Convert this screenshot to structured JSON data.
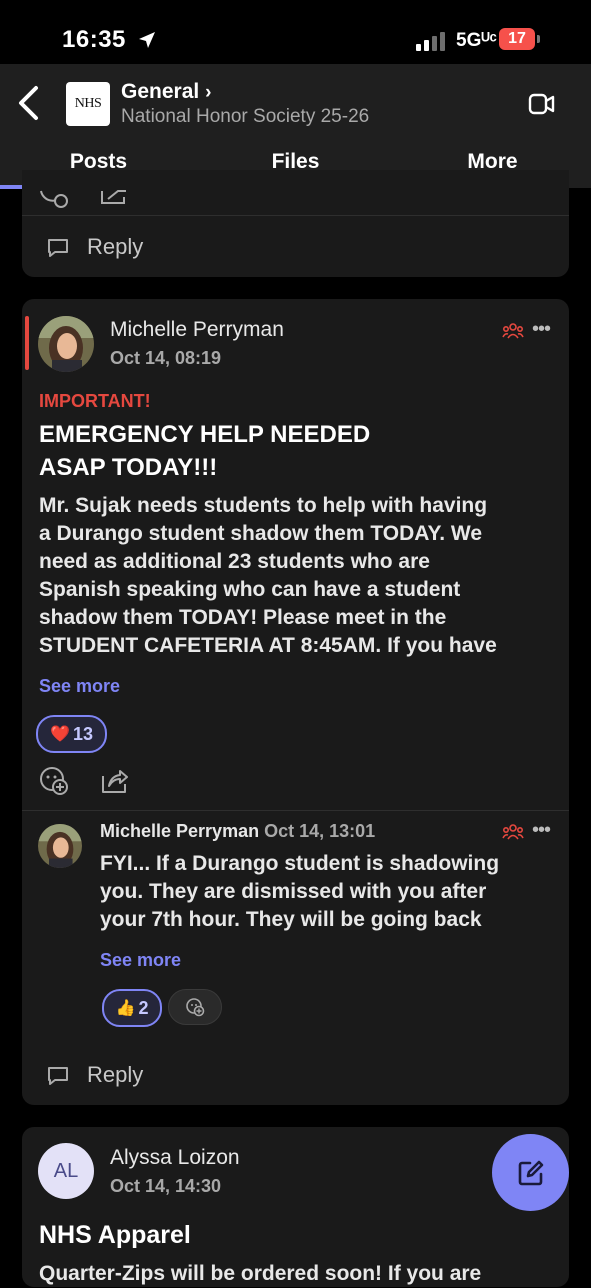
{
  "status_bar": {
    "time": "16:35",
    "network": "5Gᵁᶜ",
    "battery": "17"
  },
  "header": {
    "team_logo_text": "NHS",
    "channel": "General",
    "team": "National Honor Society 25-26",
    "tabs": [
      "Posts",
      "Files",
      "More"
    ],
    "active_tab": "Posts"
  },
  "prev_thread": {
    "reply_label": "Reply"
  },
  "post1": {
    "author": "Michelle Perryman",
    "time": "Oct 14, 08:19",
    "importance": "IMPORTANT!",
    "subject_line1": "EMERGENCY HELP NEEDED",
    "subject_line2": "ASAP TODAY!!!",
    "body_lines": [
      "Mr. Sujak needs students to help with having",
      "a Durango student shadow them TODAY.  We",
      "need as additional 23 students who are",
      "Spanish speaking who can have a student",
      "shadow them TODAY!  Please meet in the",
      "STUDENT CAFETERIA AT 8:45AM.  If you have"
    ],
    "see_more": "See more",
    "reaction": {
      "emoji": "❤️",
      "count": "13"
    },
    "reply": {
      "author": "Michelle Perryman",
      "time": "Oct 14, 13:01",
      "body_lines": [
        "FYI... If a Durango student is shadowing",
        "you.  They are dismissed with you after",
        "your 7th hour.  They will be going back"
      ],
      "see_more": "See more",
      "reaction": {
        "emoji": "👍",
        "count": "2"
      }
    },
    "reply_label": "Reply"
  },
  "post2": {
    "initials": "AL",
    "author": "Alyssa Loizon",
    "time": "Oct 14, 14:30",
    "subject": "NHS Apparel",
    "body_first_line": "Quarter-Zips will be ordered soon! If you are"
  },
  "colors": {
    "accent": "#7f85f5",
    "important": "#e5483f",
    "card": "#1a1a1a",
    "header": "#1f1f1f"
  },
  "icons": [
    "location-arrow-icon",
    "back-chevron-icon",
    "video-call-icon",
    "add-reaction-icon",
    "share-icon",
    "reply-icon",
    "people-icon",
    "more-icon",
    "compose-icon"
  ]
}
